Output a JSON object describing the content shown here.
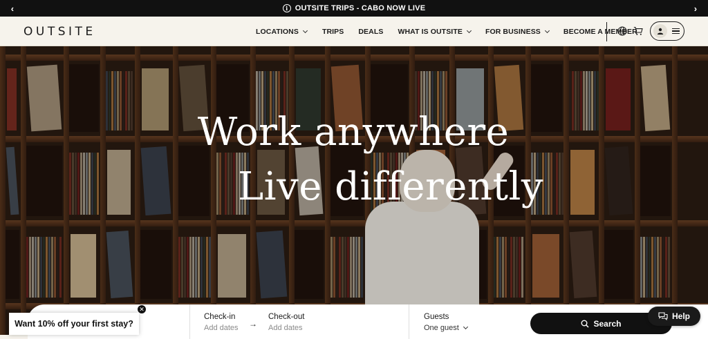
{
  "announcement": {
    "text": "OUTSITE TRIPS - CABO NOW LIVE",
    "info_glyph": "i",
    "prev_glyph": "‹",
    "next_glyph": "›"
  },
  "nav": {
    "logo": "OUTSITE",
    "items": [
      {
        "label": "LOCATIONS",
        "dropdown": true
      },
      {
        "label": "TRIPS",
        "dropdown": false
      },
      {
        "label": "DEALS",
        "dropdown": false
      },
      {
        "label": "WHAT IS OUTSITE",
        "dropdown": true
      },
      {
        "label": "FOR BUSINESS",
        "dropdown": true
      },
      {
        "label": "BECOME A MEMBER",
        "dropdown": false
      }
    ],
    "icons": [
      "globe-icon",
      "cart-icon",
      "user-icon",
      "menu-icon"
    ]
  },
  "hero": {
    "line1": "Work anywhere",
    "line2": "Live differently"
  },
  "search": {
    "checkin_label": "Check-in",
    "checkin_placeholder": "Add dates",
    "checkout_label": "Check-out",
    "checkout_placeholder": "Add dates",
    "arrow": "→",
    "guests_label": "Guests",
    "guests_value": "One guest",
    "button_label": "Search"
  },
  "help": {
    "label": "Help"
  },
  "promo": {
    "text": "Want 10% off your first stay?",
    "close_glyph": "✕"
  },
  "colors": {
    "announce_bg": "#111111",
    "nav_bg": "#f6f3ec",
    "button_dark": "#111111",
    "shelf_wood": "#5a361d"
  }
}
